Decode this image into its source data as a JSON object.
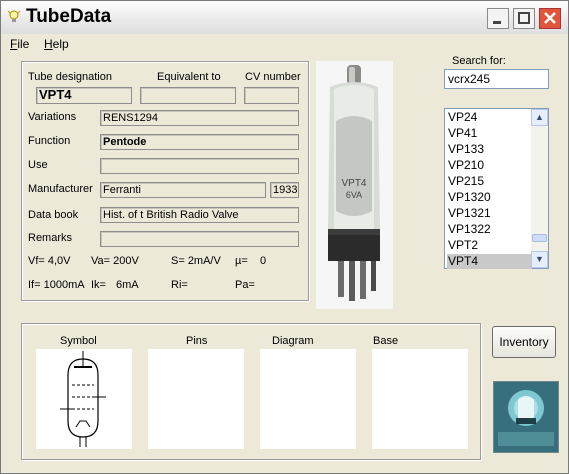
{
  "window": {
    "title": "TubeData"
  },
  "menu": [
    {
      "label": "File",
      "accel": "F",
      "rest": "ile"
    },
    {
      "label": "Help",
      "accel": "H",
      "rest": "elp"
    }
  ],
  "header_labels": {
    "designation": "Tube designation",
    "equivalent": "Equivalent to",
    "cv": "CV number"
  },
  "fields": {
    "designation": "VPT4",
    "equivalent": "",
    "cv": "",
    "variations_label": "Variations",
    "variations": "RENS1294",
    "function_label": "Function",
    "function": "Pentode",
    "use_label": "Use",
    "use": "",
    "manufacturer_label": "Manufacturer",
    "manufacturer": "Ferranti",
    "year": "1933",
    "databook_label": "Data book",
    "databook": "Hist. of t British Radio Valve",
    "remarks_label": "Remarks",
    "remarks": ""
  },
  "specs": {
    "vf": "Vf= 4,0V",
    "va": "Va= 200V",
    "s": "S= 2mA/V",
    "mu": "µ=",
    "mu_val": "0",
    "if": "If= 1000mA",
    "ik": "Ik= ",
    "ik_val": "6mA",
    "ri": "Ri=",
    "pa": "Pa="
  },
  "photo_text": {
    "line1": "VPT4",
    "line2": "6VA"
  },
  "search": {
    "label": "Search for:",
    "value": "vcrx245"
  },
  "list": {
    "items": [
      "VP24",
      "VP41",
      "VP133",
      "VP210",
      "VP215",
      "VP1320",
      "VP1321",
      "VP1322",
      "VPT2",
      "VPT4"
    ],
    "selected": "VPT4"
  },
  "bottom_labels": {
    "symbol": "Symbol",
    "pins": "Pins",
    "diagram": "Diagram",
    "base": "Base"
  },
  "buttons": {
    "inventory": "Inventory"
  },
  "icons": {
    "app": "bulb-icon",
    "minimize": "minimize-icon",
    "maximize": "maximize-icon",
    "close": "close-icon",
    "scroll_up": "chevron-up-icon",
    "scroll_down": "chevron-down-icon"
  },
  "colors": {
    "close_button": "#e0553c",
    "list_selection": "#c9c9c9",
    "logo_bg": "#37707c"
  }
}
